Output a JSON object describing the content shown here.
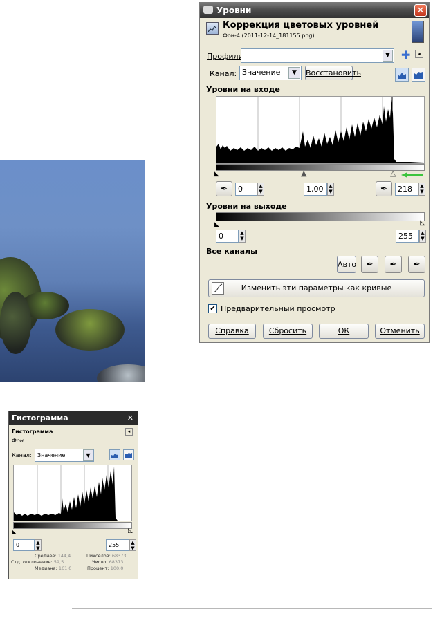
{
  "levels_dialog": {
    "window_title": "Уровни",
    "heading": "Коррекция цветовых уровней",
    "subtitle": "Фон-4 (2011-12-14_181155.png)",
    "profiles_label": "Профили:",
    "profiles_value": "",
    "channel_label": "Канал:",
    "channel_value": "Значение",
    "reset_channel_button": "Восстановить",
    "input_levels_title": "Уровни на входе",
    "input_low": "0",
    "input_gamma": "1,00",
    "input_high": "218",
    "output_levels_title": "Уровни на выходе",
    "output_low": "0",
    "output_high": "255",
    "all_channels_title": "Все каналы",
    "auto_button": "Авто",
    "curves_button": "Изменить эти параметры как кривые",
    "preview_label": "Предварительный просмотр",
    "preview_checked": true,
    "help_button": "Справка",
    "reset_button": "Сбросить",
    "ok_button": "ОК",
    "cancel_button": "Отменить",
    "arrow_color": "#3cc43c"
  },
  "histogram_dialog": {
    "window_title": "Гистограмма",
    "heading": "Гистограмма",
    "layer_name": "Фон",
    "channel_label": "Канал:",
    "channel_value": "Значение",
    "range_low": "0",
    "range_high": "255",
    "stats": {
      "mean_label": "Среднее:",
      "mean_value": "144,4",
      "std_label": "Стд. отклонение:",
      "std_value": "59,5",
      "median_label": "Медиана:",
      "median_value": "161,0",
      "pixels_label": "Пикселов:",
      "pixels_value": "68373",
      "count_label": "Число:",
      "count_value": "68373",
      "percent_label": "Процент:",
      "percent_value": "100,0"
    }
  }
}
